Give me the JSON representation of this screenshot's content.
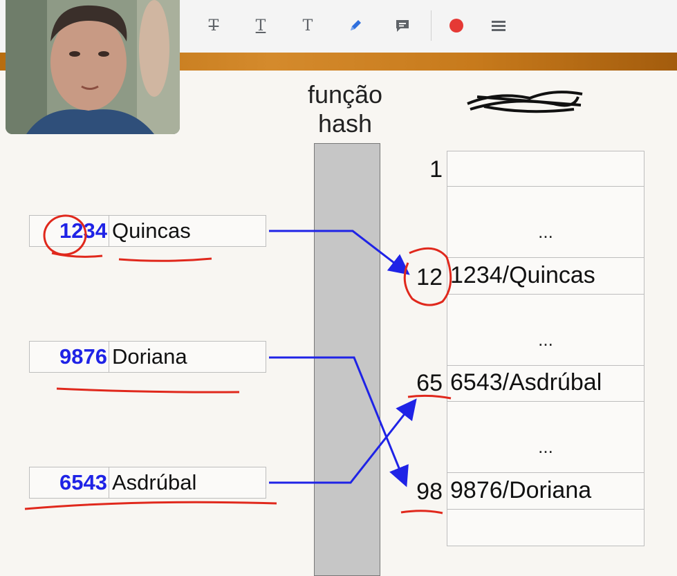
{
  "toolbar": {
    "items": [
      {
        "name": "strikethrough-text-icon",
        "glyph": "T̶"
      },
      {
        "name": "underline-text-icon",
        "glyph": "T"
      },
      {
        "name": "text-icon",
        "glyph": "T"
      },
      {
        "name": "pen-icon",
        "glyph": "✎"
      },
      {
        "name": "comment-icon",
        "glyph": "▬"
      },
      {
        "name": "record-icon",
        "color": "#e53935"
      },
      {
        "name": "menu-icon",
        "glyph": "≡"
      }
    ]
  },
  "slide": {
    "hash_title_line1": "função",
    "hash_title_line2": "hash",
    "records": [
      {
        "key": "1234",
        "name": "Quincas"
      },
      {
        "key": "9876",
        "name": "Doriana"
      },
      {
        "key": "6543",
        "name": "Asdrúbal"
      }
    ],
    "table": {
      "indices": [
        "1",
        "12",
        "65",
        "98"
      ],
      "ellipsis": "...",
      "entries": [
        "1234/Quincas",
        "6543/Asdrúbal",
        "9876/Doriana"
      ]
    }
  },
  "colors": {
    "key_text": "#1f23e6",
    "arrows": "#1f23e6",
    "annotations": "#e0281c",
    "banner": "#c77a1c"
  }
}
